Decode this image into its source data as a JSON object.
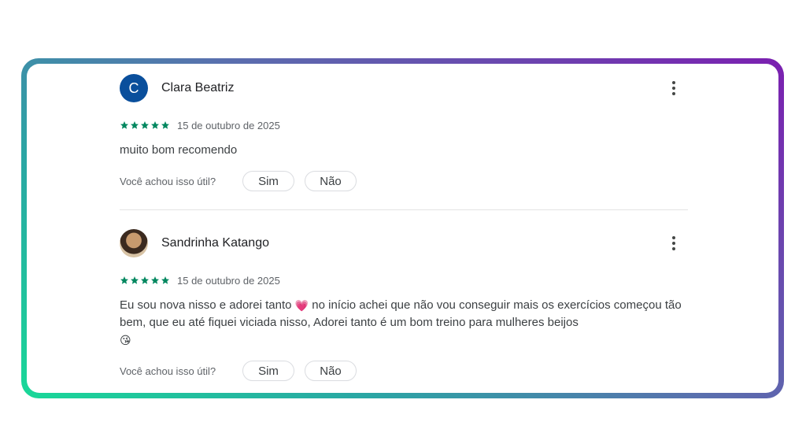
{
  "reviews": [
    {
      "avatar_letter": "C",
      "avatar_color": "#0a4f9c",
      "name": "Clara Beatriz",
      "rating": 5,
      "date": "15 de outubro de 2025",
      "text": "muito bom recomendo",
      "helpful_prompt": "Você achou isso útil?",
      "yes_label": "Sim",
      "no_label": "Não"
    },
    {
      "avatar_letter": "",
      "name": "Sandrinha Katango",
      "rating": 5,
      "date": "15 de outubro de 2025",
      "text_part1": "Eu sou nova nisso e adorei tanto",
      "emoji_heart": "💗",
      "text_part2": " no início achei que não vou conseguir mais os exercícios começou tão bem, que eu até fiquei viciada nisso, Adorei tanto é um bom treino para mulheres beijos",
      "emoji_kiss": "😘",
      "helpful_prompt": "Você achou isso útil?",
      "yes_label": "Sim",
      "no_label": "Não"
    }
  ],
  "colors": {
    "star": "#01875f",
    "frame_gradient_start": "#19d898",
    "frame_gradient_end": "#7b1fb0"
  },
  "icons": {
    "more": "more-vert-icon",
    "star": "star-icon"
  }
}
